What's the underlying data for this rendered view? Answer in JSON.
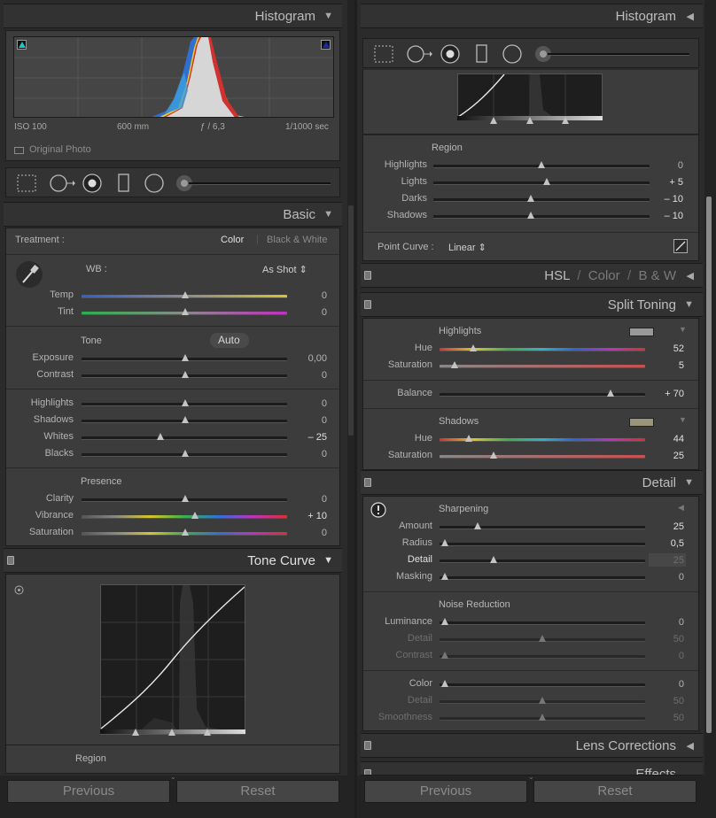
{
  "left": {
    "histogram": {
      "title": "Histogram",
      "iso": "ISO 100",
      "focal": "600 mm",
      "aperture": "ƒ / 6,3",
      "shutter": "1/1000 sec",
      "original_photo": "Original Photo"
    },
    "basic": {
      "title": "Basic",
      "treatment_label": "Treatment :",
      "treatment_color": "Color",
      "treatment_bw": "Black & White",
      "wb_label": "WB :",
      "wb_value": "As Shot ⇕",
      "temp": {
        "label": "Temp",
        "value": "0"
      },
      "tint": {
        "label": "Tint",
        "value": "0"
      },
      "tone_label": "Tone",
      "auto_label": "Auto",
      "exposure": {
        "label": "Exposure",
        "value": "0,00"
      },
      "contrast": {
        "label": "Contrast",
        "value": "0"
      },
      "highlights": {
        "label": "Highlights",
        "value": "0"
      },
      "shadows": {
        "label": "Shadows",
        "value": "0"
      },
      "whites": {
        "label": "Whites",
        "value": "– 25"
      },
      "blacks": {
        "label": "Blacks",
        "value": "0"
      },
      "presence_label": "Presence",
      "clarity": {
        "label": "Clarity",
        "value": "0"
      },
      "vibrance": {
        "label": "Vibrance",
        "value": "+ 10"
      },
      "saturation": {
        "label": "Saturation",
        "value": "0"
      }
    },
    "tone_curve": {
      "title": "Tone Curve",
      "region_label": "Region"
    },
    "buttons": {
      "previous": "Previous",
      "reset": "Reset"
    }
  },
  "right": {
    "histogram": {
      "title": "Histogram"
    },
    "tone_curve": {
      "region_label": "Region",
      "highlights": {
        "label": "Highlights",
        "value": "0"
      },
      "lights": {
        "label": "Lights",
        "value": "+ 5"
      },
      "darks": {
        "label": "Darks",
        "value": "– 10"
      },
      "shadows": {
        "label": "Shadows",
        "value": "– 10"
      },
      "point_curve_label": "Point Curve :",
      "point_curve_value": "Linear ⇕"
    },
    "hsl": {
      "tab_hsl": "HSL",
      "tab_color": "Color",
      "tab_bw": "B & W"
    },
    "split_toning": {
      "title": "Split Toning",
      "highlights_label": "Highlights",
      "hl_hue": {
        "label": "Hue",
        "value": "52"
      },
      "hl_sat": {
        "label": "Saturation",
        "value": "5"
      },
      "balance": {
        "label": "Balance",
        "value": "+ 70"
      },
      "shadows_label": "Shadows",
      "sh_hue": {
        "label": "Hue",
        "value": "44"
      },
      "sh_sat": {
        "label": "Saturation",
        "value": "25"
      }
    },
    "detail": {
      "title": "Detail",
      "sharpening_label": "Sharpening",
      "amount": {
        "label": "Amount",
        "value": "25"
      },
      "radius": {
        "label": "Radius",
        "value": "0,5"
      },
      "detail": {
        "label": "Detail",
        "value": "25"
      },
      "masking": {
        "label": "Masking",
        "value": "0"
      },
      "noise_label": "Noise Reduction",
      "luminance": {
        "label": "Luminance",
        "value": "0"
      },
      "lum_detail": {
        "label": "Detail",
        "value": "50"
      },
      "lum_contrast": {
        "label": "Contrast",
        "value": "0"
      },
      "color": {
        "label": "Color",
        "value": "0"
      },
      "color_detail": {
        "label": "Detail",
        "value": "50"
      },
      "smoothness": {
        "label": "Smoothness",
        "value": "50"
      }
    },
    "lens_corrections_title": "Lens Corrections",
    "effects_title": "Effects",
    "buttons": {
      "previous": "Previous",
      "reset": "Reset"
    }
  }
}
